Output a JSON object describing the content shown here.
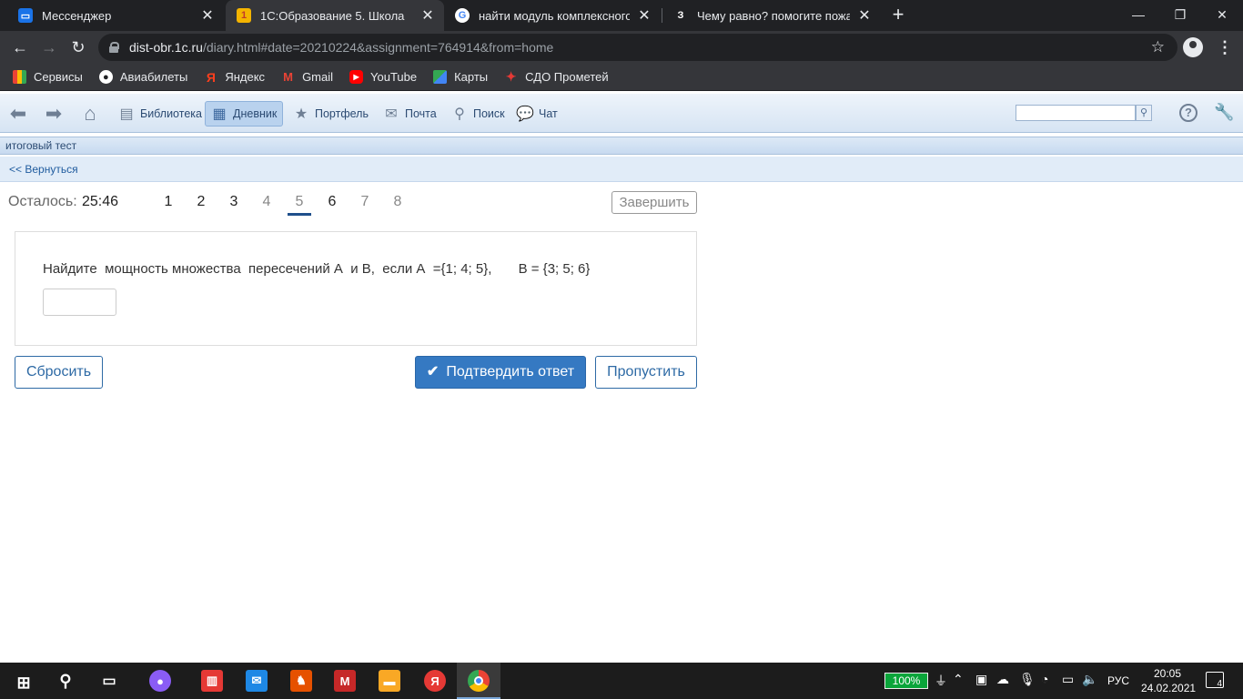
{
  "browser": {
    "tabs": [
      {
        "title": "Мессенджер",
        "active": false
      },
      {
        "title": "1С:Образование 5. Школа",
        "active": true
      },
      {
        "title": "найти модуль комплексного чи",
        "active": false
      },
      {
        "title": "Чему равно? помогите пожалуй",
        "active": false
      }
    ],
    "url_host": "dist-obr.1c.ru",
    "url_path": "/diary.html#date=20210224&assignment=764914&from=home",
    "bookmarks": [
      "Сервисы",
      "Авиабилеты",
      "Яндекс",
      "Gmail",
      "YouTube",
      "Карты",
      "СДО Прометей"
    ]
  },
  "app": {
    "nav": [
      "Библиотека",
      "Дневник",
      "Портфель",
      "Почта",
      "Поиск",
      "Чат"
    ],
    "active_nav": "Дневник",
    "search_placeholder": ""
  },
  "page": {
    "title": "итоговый тест",
    "back_link": "<< Вернуться"
  },
  "test": {
    "timer_label": "Осталось:",
    "timer_value": "25:46",
    "question_numbers": [
      "1",
      "2",
      "3",
      "4",
      "5",
      "6",
      "7",
      "8"
    ],
    "current_question": "5",
    "finish_label": "Завершить",
    "question_text": "Найдите  мощность множества  пересечений А  и В,  если А  ={1; 4; 5},       В = {3; 5; 6}",
    "answer_value": "",
    "reset_label": "Сбросить",
    "confirm_label": "Подтвердить ответ",
    "skip_label": "Пропустить"
  },
  "taskbar": {
    "battery": "100%",
    "language": "РУС",
    "time": "20:05",
    "date": "24.02.2021",
    "notifications": "4"
  }
}
